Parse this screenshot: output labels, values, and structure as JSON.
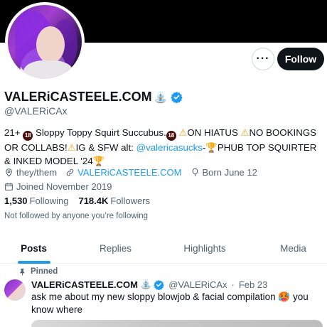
{
  "profile": {
    "display_name": "VALERiCASTEELE.COM",
    "name_emoji": "⛲",
    "handle": "@VALERiCAx",
    "verified": true,
    "bio": {
      "prefix": "21+",
      "age_badge": "18",
      "part1": "Sloppy Toppy Squirt Succubus.",
      "warn1": "⚠",
      "part2": "ON HIATUS",
      "warn2": "⚠",
      "part3": "NO BOOKINGS OR COLLABS!",
      "warn3": "⚠",
      "part4": "IG & SFW alt:",
      "link": "@valericasucks",
      "part5": "-",
      "trophy1": "🏆",
      "part6": "PHUB TOP SQUIRTER & INKED MODEL '24",
      "trophy2": "🏆"
    },
    "pronouns": "they/them",
    "website": "VALERiCASTEELE.COM",
    "birthday": "Born June 12",
    "joined": "Joined November 2019",
    "following_count": "1,530",
    "following_label": "Following",
    "followers_count": "718.4K",
    "followers_label": "Followers",
    "not_followed_text": "Not followed by anyone you’re following"
  },
  "actions": {
    "more_label": "···",
    "follow_label": "Follow"
  },
  "tabs": [
    {
      "label": "Posts",
      "active": true
    },
    {
      "label": "Replies",
      "active": false
    },
    {
      "label": "Highlights",
      "active": false
    },
    {
      "label": "Media",
      "active": false
    }
  ],
  "pinned_post": {
    "pinned_label": "Pinned",
    "author_name": "VALERiCASTEELE.COM",
    "author_emoji": "⛲",
    "author_handle": "@VALERiCAx",
    "separator": "·",
    "date": "Feb 23",
    "text": "ask me about my new sloppy blowjob & facial compilation 🥵 you know where"
  },
  "colors": {
    "accent": "#1d9bf0",
    "text_primary": "#0f1419",
    "text_secondary": "#536471",
    "banner": "#000000"
  },
  "icons": [
    "more-icon",
    "verified-badge-icon",
    "location-icon",
    "link-icon",
    "balloon-icon",
    "calendar-icon",
    "pin-icon"
  ]
}
